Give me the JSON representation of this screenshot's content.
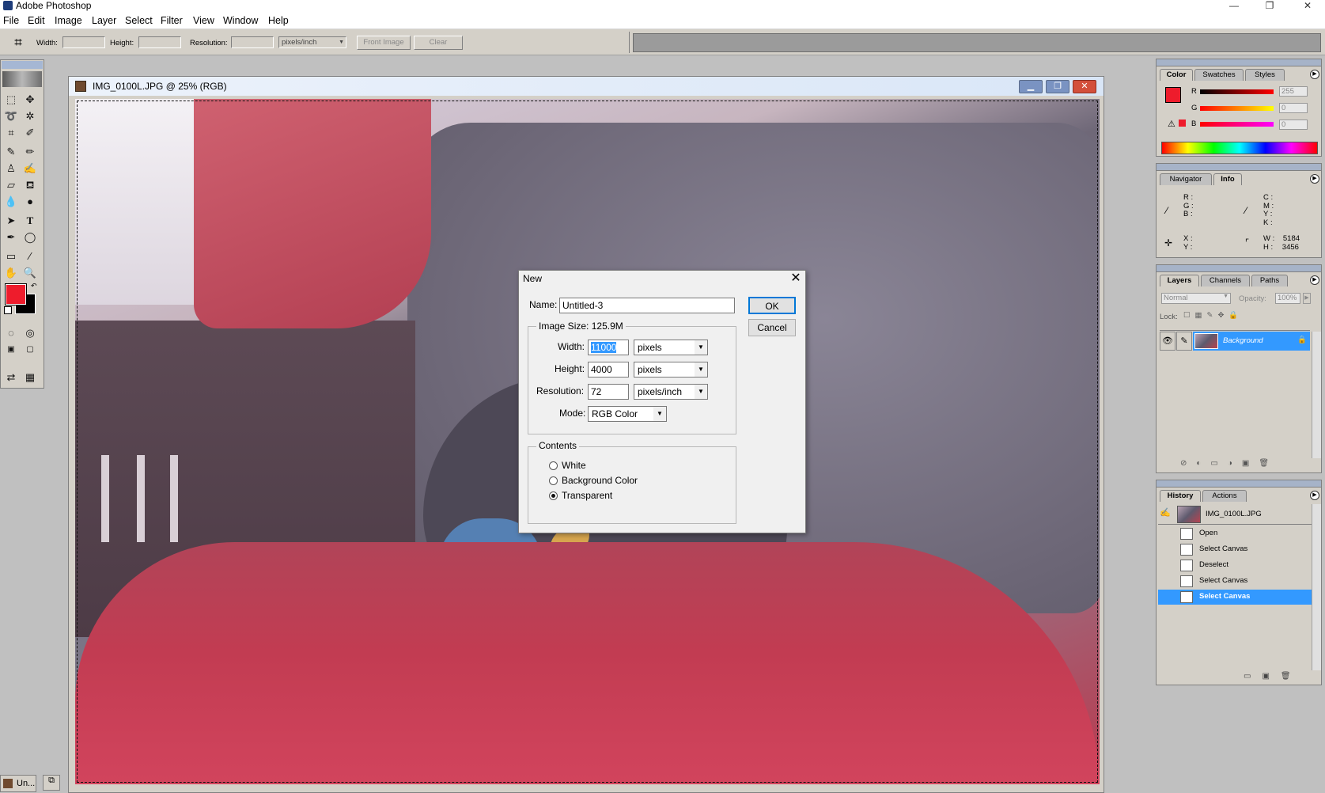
{
  "app": {
    "title": "Adobe Photoshop"
  },
  "window_controls": {
    "minimize": "—",
    "restore": "❐",
    "close": "✕"
  },
  "menu": [
    "File",
    "Edit",
    "Image",
    "Layer",
    "Select",
    "Filter",
    "View",
    "Window",
    "Help"
  ],
  "options_bar": {
    "width_label": "Width:",
    "height_label": "Height:",
    "resolution_label": "Resolution:",
    "units": "pixels/inch",
    "front_image": "Front Image",
    "clear": "Clear"
  },
  "document": {
    "title": "IMG_0100L.JPG @ 25% (RGB)",
    "taskbar_label": "Un..."
  },
  "new_dialog": {
    "title": "New",
    "name_label": "Name:",
    "name_value": "Untitled-3",
    "image_size_label": "Image Size:",
    "image_size_value": "125.9M",
    "width_label": "Width:",
    "width_value": "11000",
    "width_unit": "pixels",
    "height_label": "Height:",
    "height_value": "4000",
    "height_unit": "pixels",
    "resolution_label": "Resolution:",
    "resolution_value": "72",
    "resolution_unit": "pixels/inch",
    "mode_label": "Mode:",
    "mode_value": "RGB Color",
    "contents_label": "Contents",
    "contents_options": [
      "White",
      "Background Color",
      "Transparent"
    ],
    "contents_selected": "Transparent",
    "ok": "OK",
    "cancel": "Cancel"
  },
  "color_panel": {
    "tabs": [
      "Color",
      "Swatches",
      "Styles"
    ],
    "active_tab": "Color",
    "r_label": "R",
    "r_value": "255",
    "g_label": "G",
    "g_value": "0",
    "b_label": "B",
    "b_value": "0",
    "foreground_color": "#ee1c2c",
    "background_color": "#000000"
  },
  "info_panel": {
    "tabs": [
      "Navigator",
      "Info"
    ],
    "active_tab": "Info",
    "rgb_labels": [
      "R :",
      "G :",
      "B :"
    ],
    "cmyk_labels": [
      "C :",
      "M :",
      "Y :",
      "K :"
    ],
    "xy_labels": [
      "X :",
      "Y :"
    ],
    "w_label": "W :",
    "w_value": "5184",
    "h_label": "H :",
    "h_value": "3456"
  },
  "layers_panel": {
    "tabs": [
      "Layers",
      "Channels",
      "Paths"
    ],
    "active_tab": "Layers",
    "blend_mode": "Normal",
    "opacity_label": "Opacity:",
    "opacity_value": "100%",
    "lock_label": "Lock:",
    "layer_name": "Background"
  },
  "history_panel": {
    "tabs": [
      "History",
      "Actions"
    ],
    "active_tab": "History",
    "snapshot": "IMG_0100L.JPG",
    "items": [
      "Open",
      "Select Canvas",
      "Deselect",
      "Select Canvas",
      "Select Canvas"
    ],
    "selected_index": 4
  },
  "colors": {
    "selection": "#3399ff",
    "accent_red": "#ee1c2c"
  }
}
